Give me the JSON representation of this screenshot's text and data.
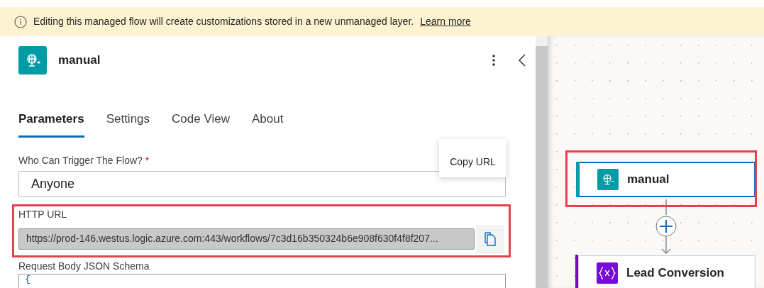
{
  "banner": {
    "text": "Editing this managed flow will create customizations stored in a new unmanaged layer.",
    "link": "Learn more"
  },
  "panel": {
    "title": "manual",
    "tabs": [
      {
        "label": "Parameters",
        "selected": true
      },
      {
        "label": "Settings",
        "selected": false
      },
      {
        "label": "Code View",
        "selected": false
      },
      {
        "label": "About",
        "selected": false
      }
    ],
    "who_can_trigger": {
      "label": "Who Can Trigger The Flow?",
      "required_mark": "*",
      "value": "Anyone"
    },
    "http_url": {
      "label": "HTTP URL",
      "value": "https://prod-146.westus.logic.azure.com:443/workflows/7c3d16b350324b6e908f630f4f8f207...",
      "tooltip": "Copy URL",
      "highlighted": true
    },
    "schema": {
      "label": "Request Body JSON Schema",
      "code": "{"
    }
  },
  "canvas": {
    "nodes": [
      {
        "title": "manual",
        "kind": "trigger",
        "selected": true,
        "highlighted": true
      },
      {
        "title": "Lead Conversion",
        "kind": "variable",
        "selected": false,
        "highlighted": false
      }
    ]
  }
}
